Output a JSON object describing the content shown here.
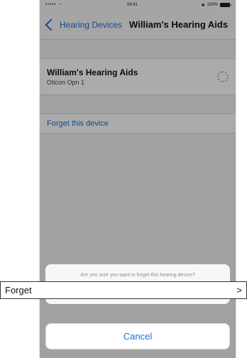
{
  "status_bar": {
    "signal": "•••••",
    "time": "09:41",
    "battery_text": "100%"
  },
  "nav": {
    "back_label": "Hearing Devices",
    "title": "William's Hearing Aids"
  },
  "device": {
    "name": "William's Hearing Aids",
    "model": "Oticon Opn 1"
  },
  "forget_row": {
    "label": "Forget this device"
  },
  "action_sheet": {
    "message": "Are you sure you want to forget this hearing device?",
    "forget_label": "Forget",
    "forget_chevron": ">",
    "cancel_label": "Cancel"
  },
  "colors": {
    "accent": "#1e6fd9",
    "overlay": "rgba(0,0,0,0.33)"
  }
}
